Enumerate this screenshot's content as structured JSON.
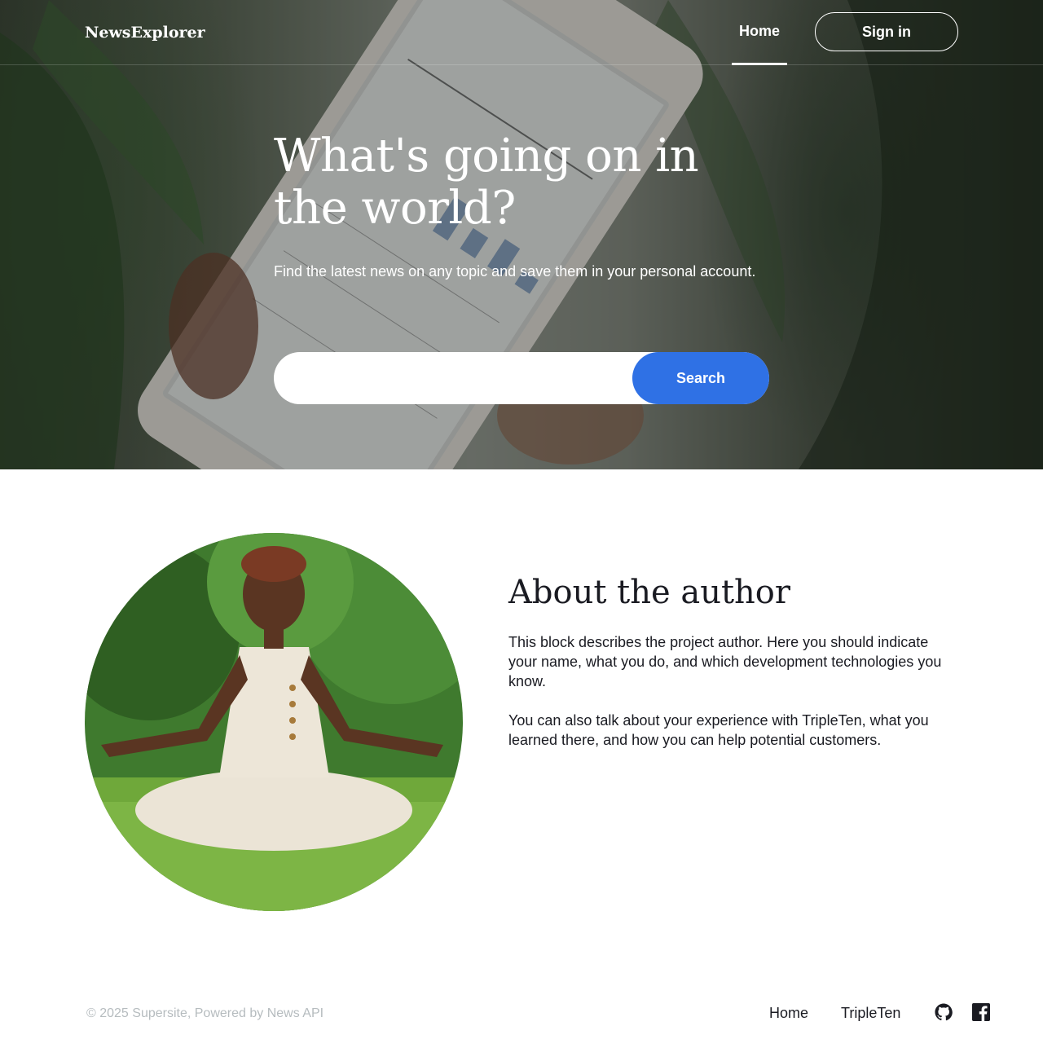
{
  "header": {
    "logo": "NewsExplorer",
    "nav_home": "Home",
    "sign_in": "Sign in"
  },
  "hero": {
    "title": "What's going on in the world?",
    "subtitle": "Find the latest news on any topic and save them in your personal account.",
    "search_placeholder": "",
    "search_value": "",
    "search_button": "Search"
  },
  "about": {
    "title": "About the author",
    "paragraph_1": "This block describes the project author. Here you should indicate your name, what you do, and which development technologies you know.",
    "paragraph_2": "You can also talk about your experience with TripleTen, what you learned there, and how you can help potential customers."
  },
  "footer": {
    "copyright": "© 2025 Supersite, Powered by News API",
    "link_home": "Home",
    "link_tripleten": "TripleTen",
    "icons": [
      "github-icon",
      "facebook-icon"
    ]
  },
  "colors": {
    "accent": "#2f71e5",
    "text": "#1a1b22",
    "muted": "#b6bcbf"
  }
}
